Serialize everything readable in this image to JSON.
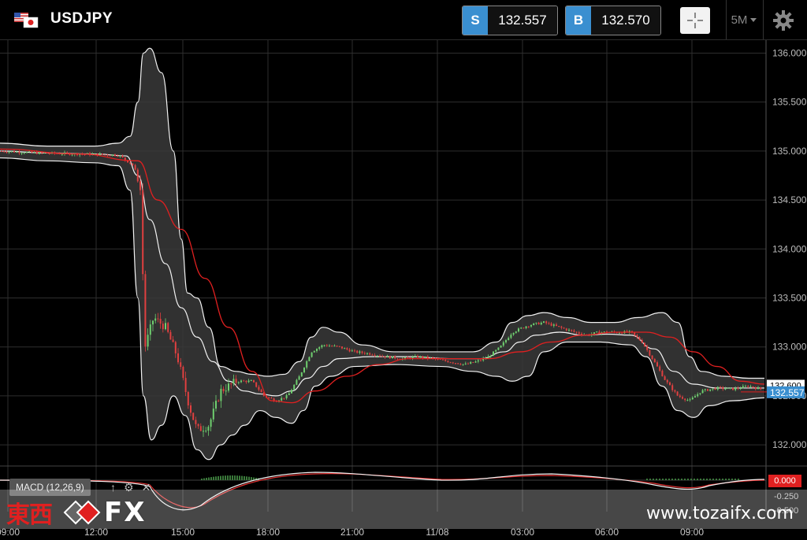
{
  "header": {
    "symbol": "USDJPY",
    "sell": {
      "label": "S",
      "price": "132.557"
    },
    "buy": {
      "label": "B",
      "price": "132.570"
    },
    "timeframe": "5M"
  },
  "chart_data": {
    "type": "candlestick",
    "instrument": "USDJPY",
    "timeframe": "5M",
    "ylim": [
      131.8,
      136.1
    ],
    "y_ticks": [
      "136.000",
      "135.500",
      "135.000",
      "134.500",
      "134.000",
      "133.500",
      "133.000",
      "132.500",
      "132.000"
    ],
    "x_ticks": [
      "09:00",
      "12:00",
      "15:00",
      "18:00",
      "21:00",
      "11/08",
      "03:00",
      "06:00",
      "09:00"
    ],
    "current_price_label": "132.557",
    "ma_price_label": "132.600",
    "price_path": [
      [
        0,
        135.0
      ],
      [
        50,
        134.98
      ],
      [
        100,
        134.97
      ],
      [
        150,
        134.96
      ],
      [
        170,
        134.85
      ],
      [
        178,
        134.6
      ],
      [
        184,
        133.0
      ],
      [
        195,
        133.3
      ],
      [
        210,
        133.2
      ],
      [
        225,
        132.9
      ],
      [
        240,
        132.4
      ],
      [
        250,
        132.15
      ],
      [
        265,
        132.2
      ],
      [
        280,
        132.55
      ],
      [
        300,
        132.65
      ],
      [
        320,
        132.65
      ],
      [
        335,
        132.5
      ],
      [
        350,
        132.45
      ],
      [
        365,
        132.5
      ],
      [
        380,
        132.7
      ],
      [
        395,
        132.95
      ],
      [
        410,
        133.02
      ],
      [
        430,
        133.0
      ],
      [
        450,
        132.95
      ],
      [
        470,
        132.93
      ],
      [
        490,
        132.9
      ],
      [
        510,
        132.88
      ],
      [
        530,
        132.9
      ],
      [
        550,
        132.88
      ],
      [
        570,
        132.85
      ],
      [
        590,
        132.82
      ],
      [
        605,
        132.85
      ],
      [
        620,
        132.9
      ],
      [
        635,
        133.0
      ],
      [
        650,
        133.15
      ],
      [
        670,
        133.22
      ],
      [
        690,
        133.25
      ],
      [
        710,
        133.2
      ],
      [
        730,
        133.15
      ],
      [
        745,
        133.12
      ],
      [
        760,
        133.15
      ],
      [
        780,
        133.15
      ],
      [
        800,
        133.15
      ],
      [
        815,
        133.05
      ],
      [
        830,
        132.85
      ],
      [
        845,
        132.65
      ],
      [
        860,
        132.5
      ],
      [
        875,
        132.45
      ],
      [
        890,
        132.55
      ],
      [
        910,
        132.58
      ],
      [
        930,
        132.57
      ],
      [
        950,
        132.6
      ],
      [
        970,
        132.56
      ]
    ],
    "bollinger_upper": [
      [
        0,
        135.08
      ],
      [
        60,
        135.05
      ],
      [
        120,
        135.05
      ],
      [
        150,
        135.08
      ],
      [
        165,
        135.15
      ],
      [
        175,
        135.5
      ],
      [
        182,
        136.0
      ],
      [
        190,
        136.05
      ],
      [
        205,
        135.8
      ],
      [
        220,
        135.0
      ],
      [
        230,
        134.1
      ],
      [
        238,
        133.55
      ],
      [
        250,
        133.5
      ],
      [
        265,
        133.2
      ],
      [
        280,
        132.8
      ],
      [
        300,
        132.75
      ],
      [
        320,
        132.72
      ],
      [
        340,
        132.7
      ],
      [
        360,
        132.72
      ],
      [
        380,
        132.85
      ],
      [
        395,
        133.1
      ],
      [
        410,
        133.2
      ],
      [
        430,
        133.15
      ],
      [
        460,
        133.02
      ],
      [
        500,
        132.95
      ],
      [
        560,
        132.95
      ],
      [
        600,
        132.95
      ],
      [
        630,
        133.05
      ],
      [
        650,
        133.25
      ],
      [
        670,
        133.32
      ],
      [
        690,
        133.35
      ],
      [
        720,
        133.3
      ],
      [
        750,
        133.25
      ],
      [
        780,
        133.25
      ],
      [
        810,
        133.3
      ],
      [
        840,
        133.35
      ],
      [
        860,
        133.25
      ],
      [
        875,
        132.9
      ],
      [
        890,
        132.75
      ],
      [
        920,
        132.7
      ],
      [
        950,
        132.68
      ],
      [
        970,
        132.68
      ]
    ],
    "bollinger_mid": [
      [
        0,
        135.0
      ],
      [
        60,
        134.98
      ],
      [
        120,
        134.97
      ],
      [
        160,
        134.95
      ],
      [
        175,
        134.75
      ],
      [
        190,
        134.3
      ],
      [
        210,
        133.85
      ],
      [
        230,
        133.4
      ],
      [
        250,
        133.1
      ],
      [
        270,
        132.85
      ],
      [
        290,
        132.65
      ],
      [
        310,
        132.55
      ],
      [
        330,
        132.52
      ],
      [
        350,
        132.5
      ],
      [
        370,
        132.55
      ],
      [
        390,
        132.68
      ],
      [
        410,
        132.8
      ],
      [
        430,
        132.88
      ],
      [
        470,
        132.9
      ],
      [
        520,
        132.9
      ],
      [
        570,
        132.88
      ],
      [
        610,
        132.88
      ],
      [
        640,
        132.95
      ],
      [
        660,
        133.05
      ],
      [
        680,
        133.12
      ],
      [
        710,
        133.15
      ],
      [
        740,
        133.12
      ],
      [
        770,
        133.13
      ],
      [
        800,
        133.12
      ],
      [
        830,
        132.98
      ],
      [
        855,
        132.75
      ],
      [
        880,
        132.62
      ],
      [
        910,
        132.58
      ],
      [
        940,
        132.58
      ],
      [
        970,
        132.58
      ]
    ],
    "bollinger_lower": [
      [
        0,
        134.93
      ],
      [
        60,
        134.9
      ],
      [
        120,
        134.88
      ],
      [
        150,
        134.85
      ],
      [
        165,
        134.6
      ],
      [
        175,
        133.5
      ],
      [
        182,
        132.5
      ],
      [
        192,
        132.05
      ],
      [
        205,
        132.2
      ],
      [
        220,
        132.5
      ],
      [
        235,
        132.3
      ],
      [
        250,
        131.95
      ],
      [
        265,
        131.85
      ],
      [
        280,
        132.0
      ],
      [
        295,
        132.1
      ],
      [
        310,
        132.2
      ],
      [
        330,
        132.35
      ],
      [
        350,
        132.28
      ],
      [
        370,
        132.22
      ],
      [
        385,
        132.35
      ],
      [
        400,
        132.6
      ],
      [
        420,
        132.7
      ],
      [
        450,
        132.8
      ],
      [
        500,
        132.82
      ],
      [
        560,
        132.8
      ],
      [
        600,
        132.75
      ],
      [
        630,
        132.7
      ],
      [
        650,
        132.65
      ],
      [
        670,
        132.7
      ],
      [
        690,
        132.95
      ],
      [
        720,
        133.05
      ],
      [
        760,
        133.05
      ],
      [
        800,
        133.02
      ],
      [
        820,
        132.9
      ],
      [
        840,
        132.6
      ],
      [
        860,
        132.35
      ],
      [
        880,
        132.28
      ],
      [
        900,
        132.4
      ],
      [
        930,
        132.45
      ],
      [
        970,
        132.48
      ]
    ],
    "moving_average": [
      [
        0,
        135.02
      ],
      [
        100,
        134.97
      ],
      [
        175,
        134.9
      ],
      [
        200,
        134.5
      ],
      [
        230,
        134.2
      ],
      [
        260,
        133.7
      ],
      [
        290,
        133.2
      ],
      [
        320,
        132.75
      ],
      [
        345,
        132.45
      ],
      [
        370,
        132.43
      ],
      [
        400,
        132.55
      ],
      [
        440,
        132.7
      ],
      [
        480,
        132.82
      ],
      [
        520,
        132.88
      ],
      [
        570,
        132.88
      ],
      [
        620,
        132.88
      ],
      [
        660,
        132.95
      ],
      [
        700,
        133.05
      ],
      [
        740,
        133.12
      ],
      [
        780,
        133.15
      ],
      [
        820,
        133.15
      ],
      [
        850,
        133.1
      ],
      [
        880,
        132.95
      ],
      [
        910,
        132.8
      ],
      [
        940,
        132.65
      ],
      [
        970,
        132.62
      ]
    ],
    "macd": {
      "label": "MACD (12,26,9)",
      "value_label": "0.000",
      "axis_labels": [
        "-0.250",
        "-0.500"
      ]
    }
  },
  "watermark": {
    "brand_kanji": "東西",
    "brand_fx": "FX",
    "url": "www.tozaifx.com"
  },
  "colors": {
    "ask_tag": "#3a8fd0",
    "ma_line": "#e02020",
    "band_fill": "#3a3a3a",
    "up_candle": "#6fcf6f",
    "down_candle": "#e04040"
  }
}
